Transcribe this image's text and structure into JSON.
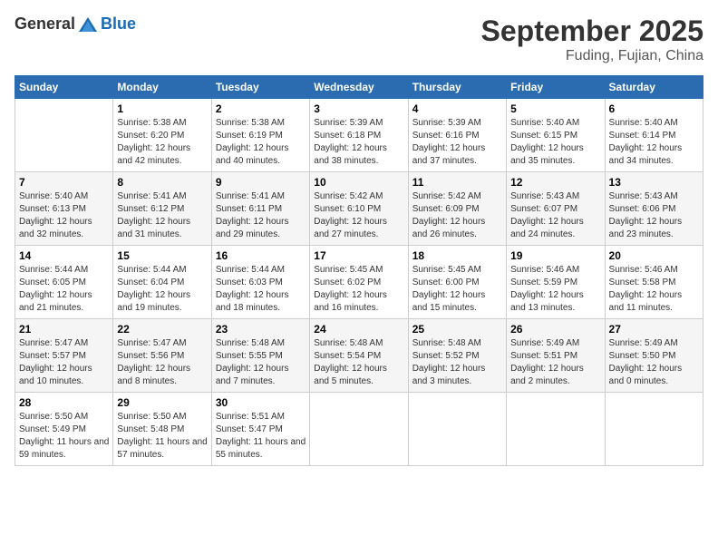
{
  "header": {
    "logo": {
      "general": "General",
      "blue": "Blue"
    },
    "title": "September 2025",
    "location": "Fuding, Fujian, China"
  },
  "weekdays": [
    "Sunday",
    "Monday",
    "Tuesday",
    "Wednesday",
    "Thursday",
    "Friday",
    "Saturday"
  ],
  "weeks": [
    [
      {
        "day": null
      },
      {
        "day": 1,
        "sunrise": "5:38 AM",
        "sunset": "6:20 PM",
        "daylight": "12 hours and 42 minutes."
      },
      {
        "day": 2,
        "sunrise": "5:38 AM",
        "sunset": "6:19 PM",
        "daylight": "12 hours and 40 minutes."
      },
      {
        "day": 3,
        "sunrise": "5:39 AM",
        "sunset": "6:18 PM",
        "daylight": "12 hours and 38 minutes."
      },
      {
        "day": 4,
        "sunrise": "5:39 AM",
        "sunset": "6:16 PM",
        "daylight": "12 hours and 37 minutes."
      },
      {
        "day": 5,
        "sunrise": "5:40 AM",
        "sunset": "6:15 PM",
        "daylight": "12 hours and 35 minutes."
      },
      {
        "day": 6,
        "sunrise": "5:40 AM",
        "sunset": "6:14 PM",
        "daylight": "12 hours and 34 minutes."
      }
    ],
    [
      {
        "day": 7,
        "sunrise": "5:40 AM",
        "sunset": "6:13 PM",
        "daylight": "12 hours and 32 minutes."
      },
      {
        "day": 8,
        "sunrise": "5:41 AM",
        "sunset": "6:12 PM",
        "daylight": "12 hours and 31 minutes."
      },
      {
        "day": 9,
        "sunrise": "5:41 AM",
        "sunset": "6:11 PM",
        "daylight": "12 hours and 29 minutes."
      },
      {
        "day": 10,
        "sunrise": "5:42 AM",
        "sunset": "6:10 PM",
        "daylight": "12 hours and 27 minutes."
      },
      {
        "day": 11,
        "sunrise": "5:42 AM",
        "sunset": "6:09 PM",
        "daylight": "12 hours and 26 minutes."
      },
      {
        "day": 12,
        "sunrise": "5:43 AM",
        "sunset": "6:07 PM",
        "daylight": "12 hours and 24 minutes."
      },
      {
        "day": 13,
        "sunrise": "5:43 AM",
        "sunset": "6:06 PM",
        "daylight": "12 hours and 23 minutes."
      }
    ],
    [
      {
        "day": 14,
        "sunrise": "5:44 AM",
        "sunset": "6:05 PM",
        "daylight": "12 hours and 21 minutes."
      },
      {
        "day": 15,
        "sunrise": "5:44 AM",
        "sunset": "6:04 PM",
        "daylight": "12 hours and 19 minutes."
      },
      {
        "day": 16,
        "sunrise": "5:44 AM",
        "sunset": "6:03 PM",
        "daylight": "12 hours and 18 minutes."
      },
      {
        "day": 17,
        "sunrise": "5:45 AM",
        "sunset": "6:02 PM",
        "daylight": "12 hours and 16 minutes."
      },
      {
        "day": 18,
        "sunrise": "5:45 AM",
        "sunset": "6:00 PM",
        "daylight": "12 hours and 15 minutes."
      },
      {
        "day": 19,
        "sunrise": "5:46 AM",
        "sunset": "5:59 PM",
        "daylight": "12 hours and 13 minutes."
      },
      {
        "day": 20,
        "sunrise": "5:46 AM",
        "sunset": "5:58 PM",
        "daylight": "12 hours and 11 minutes."
      }
    ],
    [
      {
        "day": 21,
        "sunrise": "5:47 AM",
        "sunset": "5:57 PM",
        "daylight": "12 hours and 10 minutes."
      },
      {
        "day": 22,
        "sunrise": "5:47 AM",
        "sunset": "5:56 PM",
        "daylight": "12 hours and 8 minutes."
      },
      {
        "day": 23,
        "sunrise": "5:48 AM",
        "sunset": "5:55 PM",
        "daylight": "12 hours and 7 minutes."
      },
      {
        "day": 24,
        "sunrise": "5:48 AM",
        "sunset": "5:54 PM",
        "daylight": "12 hours and 5 minutes."
      },
      {
        "day": 25,
        "sunrise": "5:48 AM",
        "sunset": "5:52 PM",
        "daylight": "12 hours and 3 minutes."
      },
      {
        "day": 26,
        "sunrise": "5:49 AM",
        "sunset": "5:51 PM",
        "daylight": "12 hours and 2 minutes."
      },
      {
        "day": 27,
        "sunrise": "5:49 AM",
        "sunset": "5:50 PM",
        "daylight": "12 hours and 0 minutes."
      }
    ],
    [
      {
        "day": 28,
        "sunrise": "5:50 AM",
        "sunset": "5:49 PM",
        "daylight": "11 hours and 59 minutes."
      },
      {
        "day": 29,
        "sunrise": "5:50 AM",
        "sunset": "5:48 PM",
        "daylight": "11 hours and 57 minutes."
      },
      {
        "day": 30,
        "sunrise": "5:51 AM",
        "sunset": "5:47 PM",
        "daylight": "11 hours and 55 minutes."
      },
      {
        "day": null
      },
      {
        "day": null
      },
      {
        "day": null
      },
      {
        "day": null
      }
    ]
  ]
}
